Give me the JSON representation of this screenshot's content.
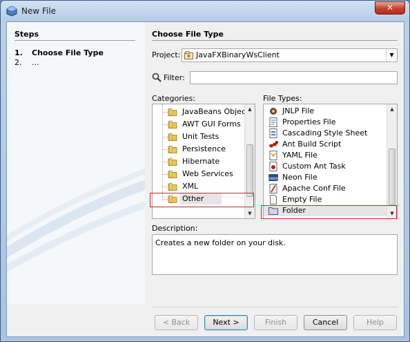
{
  "window": {
    "title": "New File",
    "close_label": "✕"
  },
  "steps": {
    "title": "Steps",
    "items": [
      {
        "num": "1.",
        "label": "Choose File Type"
      },
      {
        "num": "2.",
        "label": "..."
      }
    ]
  },
  "main": {
    "title": "Choose File Type",
    "project_label": "Project:",
    "project_value": "JavaFXBinaryWsClient",
    "filter_label": "Filter:",
    "filter_value": "",
    "categories_label": "Categories:",
    "file_types_label": "File Types:",
    "categories": [
      "JavaBeans Object",
      "AWT GUI Forms",
      "Unit Tests",
      "Persistence",
      "Hibernate",
      "Web Services",
      "XML",
      "Other"
    ],
    "selected_category": "Other",
    "file_types": [
      {
        "label": "JNLP File",
        "icon": "jnlp-icon"
      },
      {
        "label": "Properties File",
        "icon": "properties-file-icon"
      },
      {
        "label": "Cascading Style Sheet",
        "icon": "css-file-icon"
      },
      {
        "label": "Ant Build Script",
        "icon": "ant-icon"
      },
      {
        "label": "YAML File",
        "icon": "yaml-file-icon"
      },
      {
        "label": "Custom Ant Task",
        "icon": "custom-ant-task-icon"
      },
      {
        "label": "Neon File",
        "icon": "neon-file-icon"
      },
      {
        "label": "Apache Conf File",
        "icon": "apache-conf-icon"
      },
      {
        "label": "Empty File",
        "icon": "empty-file-icon"
      },
      {
        "label": "Folder",
        "icon": "folder-icon"
      }
    ],
    "selected_file_type": "Folder",
    "description_label": "Description:",
    "description_text": "Creates a new folder on your disk."
  },
  "buttons": {
    "back": "< Back",
    "next": "Next >",
    "finish": "Finish",
    "cancel": "Cancel",
    "help": "Help"
  },
  "colors": {
    "highlight_border": "#d0262d",
    "folder_yellow": "#e9c84f"
  }
}
